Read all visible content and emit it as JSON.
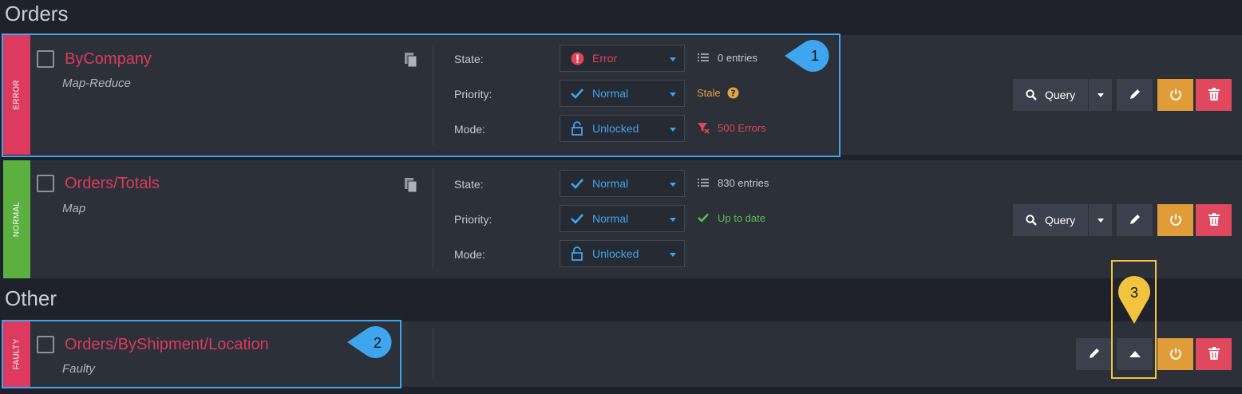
{
  "groups": [
    {
      "title": "Orders"
    },
    {
      "title": "Other"
    }
  ],
  "indexes": [
    {
      "status_strip": "ERROR",
      "name": "ByCompany",
      "type": "Map-Reduce",
      "state_label": "State:",
      "state_value": "Error",
      "priority_label": "Priority:",
      "priority_value": "Normal",
      "mode_label": "Mode:",
      "mode_value": "Unlocked",
      "entries": "0 entries",
      "staleness": "Stale",
      "errors": "500 Errors"
    },
    {
      "status_strip": "NORMAL",
      "name": "Orders/Totals",
      "type": "Map",
      "state_label": "State:",
      "state_value": "Normal",
      "priority_label": "Priority:",
      "priority_value": "Normal",
      "mode_label": "Mode:",
      "mode_value": "Unlocked",
      "entries": "830 entries",
      "staleness": "Up to date"
    },
    {
      "status_strip": "FAULTY",
      "name": "Orders/ByShipment/Location",
      "type": "Faulty"
    }
  ],
  "actions": {
    "query_label": "Query"
  },
  "callouts": [
    "1",
    "2",
    "3"
  ],
  "colors": {
    "error_red": "#dc3a5e",
    "normal_green": "#5cb040",
    "accent_blue": "#3fa5ee",
    "stale_orange": "#e5a342",
    "highlight_yellow": "#f2c33e"
  },
  "icons": {
    "status_error": "exclamation-circle-icon",
    "status_normal": "check-icon",
    "mode": "unlock-icon",
    "entries": "list-icon",
    "stale_help": "question-circle-icon",
    "errors": "filter-x-icon",
    "up_to_date": "check-icon",
    "copy": "copy-icon",
    "query": "search-icon",
    "edit": "pencil-icon",
    "disable": "power-icon",
    "delete": "trash-icon",
    "expand": "caret-up-icon"
  }
}
